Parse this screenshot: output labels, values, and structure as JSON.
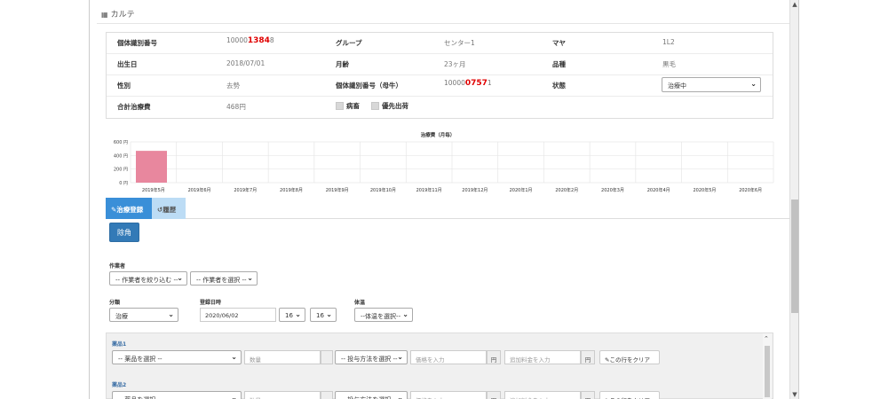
{
  "header": {
    "title": "カルテ",
    "icon": "book-icon"
  },
  "info": {
    "row1": {
      "id_label": "個体識別番号",
      "id_prefix": "10000",
      "id_highlight": "1384",
      "id_suffix": "8",
      "group_label": "グループ",
      "group_value": "センター1",
      "maya_label": "マヤ",
      "maya_value": "1L2"
    },
    "row2": {
      "birth_label": "出生日",
      "birth_value": "2018/07/01",
      "age_label": "月齢",
      "age_value": "23ヶ月",
      "breed_label": "品種",
      "breed_value": "黒毛"
    },
    "row3": {
      "sex_label": "性別",
      "sex_value": "去勢",
      "mother_label": "個体識別番号（母牛）",
      "mother_prefix": "10000",
      "mother_highlight": "0757",
      "mother_suffix": "1",
      "status_label": "状態",
      "status_value": "治療中"
    },
    "row4": {
      "cost_label": "合計治療費",
      "cost_value": "468円",
      "sick_label": "病畜",
      "priority_label": "優先出荷"
    }
  },
  "chart_data": {
    "type": "bar",
    "title": "治療費（月毎）",
    "categories": [
      "2019年5月",
      "2019年6月",
      "2019年7月",
      "2019年8月",
      "2019年9月",
      "2019年10月",
      "2019年11月",
      "2019年12月",
      "2020年1月",
      "2020年2月",
      "2020年3月",
      "2020年4月",
      "2020年5月",
      "2020年6月"
    ],
    "values": [
      468,
      0,
      0,
      0,
      0,
      0,
      0,
      0,
      0,
      0,
      0,
      0,
      0,
      0
    ],
    "yticks": [
      "0 円",
      "200 円",
      "400 円",
      "600 円"
    ],
    "ylim": [
      0,
      600
    ],
    "bar_color": "#e8879e",
    "grid": true
  },
  "tabs": [
    {
      "label": "治療登録",
      "icon": "edit-icon",
      "active": true
    },
    {
      "label": "履歴",
      "icon": "history-icon",
      "active": false
    }
  ],
  "form": {
    "dehorn_label": "除角",
    "worker_label": "作業者",
    "worker_filter": "-- 作業者を絞り込む --",
    "worker_select": "-- 作業者を選択 --",
    "category_label": "分類",
    "category_value": "治療",
    "datetime_label": "登録日時",
    "date_value": "2020/06/02",
    "hour_value": "16",
    "minute_value": "16",
    "temp_label": "体温",
    "temp_value": "--体温を選択--"
  },
  "drugs": [
    {
      "label": "薬品1",
      "drug_select": "-- 薬品を選択 --",
      "qty_placeholder": "数量",
      "method_select": "-- 投与方法を選択 --",
      "price_placeholder": "価格を入力",
      "yen1": "円",
      "fee_placeholder": "追加料金を入力",
      "yen2": "円",
      "clear_label": "この行をクリア"
    },
    {
      "label": "薬品2",
      "drug_select": "-- 薬品を選択 --",
      "qty_placeholder": "数量",
      "method_select": "-- 投与方法を選択 --",
      "price_placeholder": "価格を入力",
      "yen1": "円",
      "fee_placeholder": "追加料金を入力",
      "yen2": "円",
      "clear_label": "この行をクリア"
    }
  ]
}
